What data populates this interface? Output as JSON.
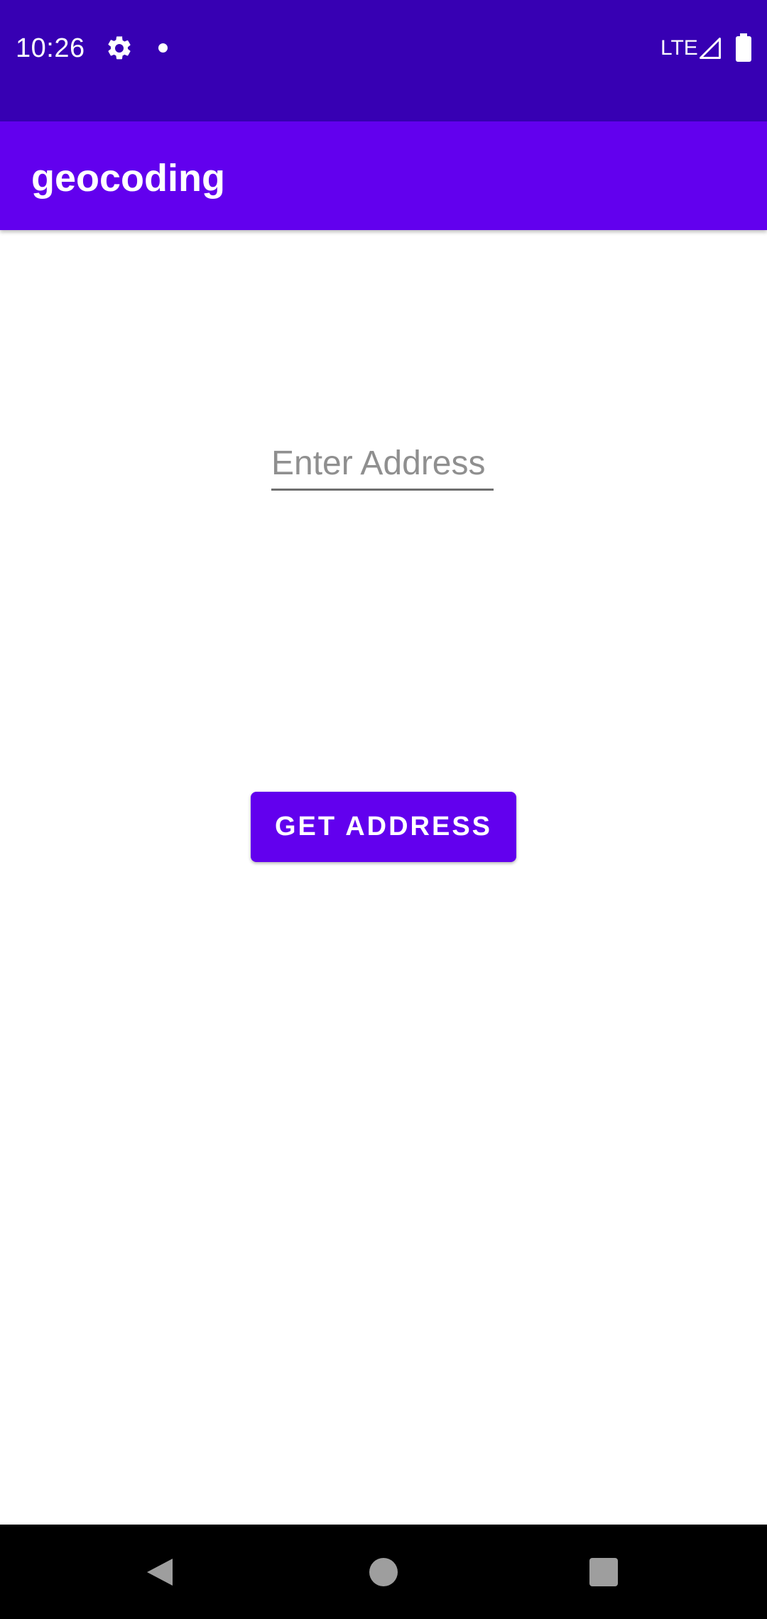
{
  "status_bar": {
    "time": "10:26",
    "network": "LTE",
    "icons": [
      "settings-gear-icon",
      "notification-dot-icon",
      "cell-signal-icon",
      "battery-icon"
    ]
  },
  "app_bar": {
    "title": "geocoding"
  },
  "main": {
    "address_input": {
      "placeholder": "Enter Address",
      "value": ""
    },
    "get_address_button": {
      "label": "GET ADDRESS"
    }
  },
  "nav_bar": {
    "icons": [
      "back-icon",
      "home-icon",
      "recents-icon"
    ]
  },
  "colors": {
    "status_bar": "#3700b3",
    "primary": "#6200ee",
    "background": "#ffffff",
    "nav_bar": "#000000"
  }
}
